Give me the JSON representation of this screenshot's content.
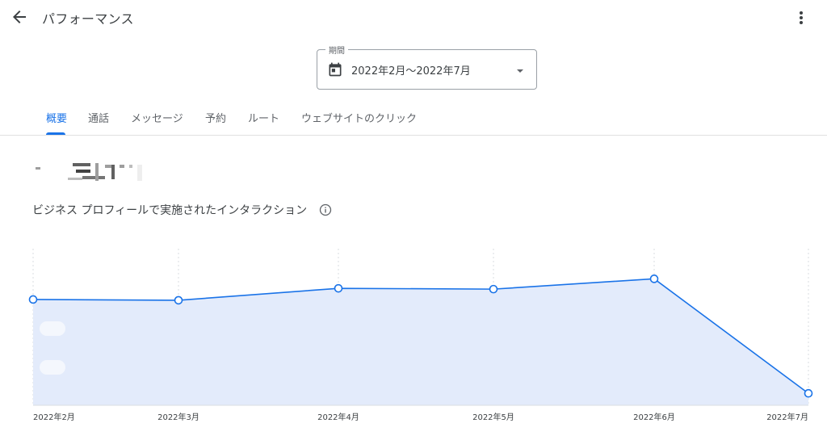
{
  "header": {
    "back_icon": "arrow-back-icon",
    "title": "パフォーマンス",
    "more_icon": "more-vert-icon"
  },
  "date_range": {
    "legend": "期間",
    "value": "2022年2月～2022年7月",
    "icon": "calendar-icon",
    "dropdown_icon": "caret-down-icon"
  },
  "tabs": [
    {
      "label": "概要",
      "active": true
    },
    {
      "label": "通話",
      "active": false
    },
    {
      "label": "メッセージ",
      "active": false
    },
    {
      "label": "予約",
      "active": false
    },
    {
      "label": "ルート",
      "active": false
    },
    {
      "label": "ウェブサイトのクリック",
      "active": false
    }
  ],
  "summary": {
    "metric_label": "ビジネス プロフィールで実施されたインタラクション",
    "info_icon": "info-icon"
  },
  "colors": {
    "accent": "#1a73e8",
    "area_fill": "#e3ebfb",
    "text": "#3c4043"
  },
  "chart_data": {
    "type": "area",
    "x": [
      "2022年2月",
      "2022年3月",
      "2022年4月",
      "2022年5月",
      "2022年6月",
      "2022年7月"
    ],
    "series": [
      {
        "values": [
          133,
          132,
          147,
          146,
          159,
          15
        ]
      }
    ],
    "ylim": [
      0,
      205
    ],
    "grid": "vertical-dashed"
  }
}
